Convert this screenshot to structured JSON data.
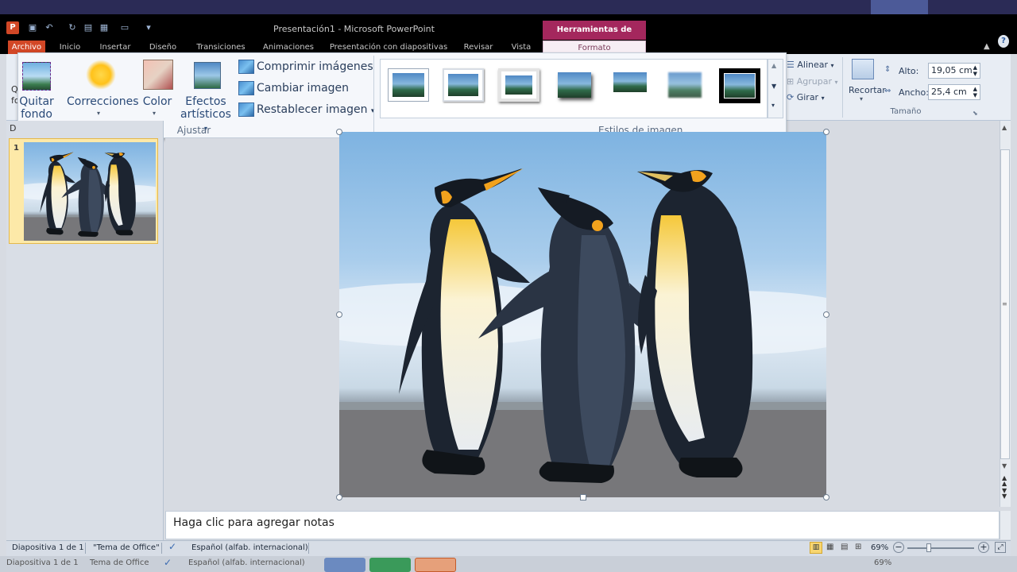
{
  "window": {
    "title": "Presentación1 - Microsoft PowerPoint",
    "app_icon": "P",
    "context_header": "Herramientas de imagen"
  },
  "quick_access": [
    "save-icon",
    "undo-icon",
    "redo-icon",
    "print-preview-icon",
    "layout-icon",
    "slide-icon",
    "customize-icon"
  ],
  "tabs": [
    {
      "label": "Archivo"
    },
    {
      "label": "Inicio"
    },
    {
      "label": "Insertar"
    },
    {
      "label": "Diseño"
    },
    {
      "label": "Transiciones"
    },
    {
      "label": "Animaciones"
    },
    {
      "label": "Presentación con diapositivas"
    },
    {
      "label": "Revisar"
    },
    {
      "label": "Vista"
    },
    {
      "label": "Formato"
    }
  ],
  "ribbon": {
    "ajustar": {
      "label": "Ajustar",
      "quitar_fondo_1": "Quitar",
      "quitar_fondo_2": "fondo",
      "correcciones": "Correcciones",
      "color": "Color",
      "efectos_1": "Efectos",
      "efectos_2": "artísticos",
      "comprimir": "Comprimir imágenes",
      "cambiar": "Cambiar imagen",
      "restablecer": "Restablecer imagen"
    },
    "estilos": {
      "label": "Estilos de imagen"
    },
    "organizar": {
      "alinear": "Alinear",
      "agrupar": "Agrupar",
      "girar": "Girar"
    },
    "tamano": {
      "label": "Tamaño",
      "recortar": "Recortar",
      "alto_label": "Alto:",
      "alto_value": "19,05 cm",
      "ancho_label": "Ancho:",
      "ancho_value": "25,4 cm"
    },
    "partial_left": {
      "top": "Q",
      "bottom": "fo",
      "panel": "D"
    }
  },
  "slides": {
    "number": "1"
  },
  "notes": {
    "placeholder": "Haga clic para agregar notas"
  },
  "status": {
    "slide_info": "Diapositiva 1 de 1",
    "theme": "\"Tema de Office\"",
    "language": "Español (alfab. internacional)",
    "zoom": "69%",
    "zoom_minus": "−",
    "zoom_plus": "+"
  },
  "status_echo": {
    "slide_info": "Diapositiva 1 de 1",
    "theme": "Tema de Office",
    "language": "Español (alfab. internacional)",
    "zoom": "69%"
  },
  "colors": {
    "accent_archivo": "#d24726",
    "context_tab": "#a4275d",
    "ribbon_bg": "#e8edf4"
  }
}
